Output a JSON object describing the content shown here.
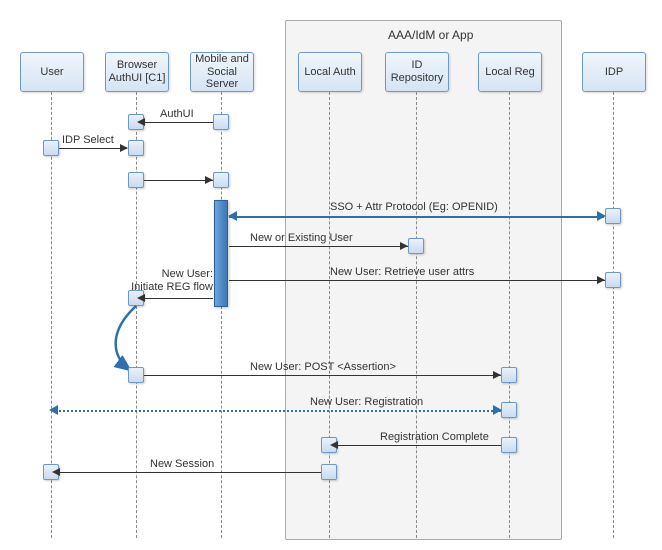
{
  "group": {
    "label": "AAA/IdM or App"
  },
  "participants": {
    "user": {
      "label": "User"
    },
    "browser": {
      "label": "Browser AuthUI [C1]"
    },
    "mss": {
      "label": "Mobile and Social Server"
    },
    "local": {
      "label": "Local Auth"
    },
    "repo": {
      "label": "ID Repository"
    },
    "reg": {
      "label": "Local Reg"
    },
    "idp": {
      "label": "IDP"
    }
  },
  "messages": {
    "authui": "AuthUI",
    "idp_select": "IDP Select",
    "sso": "SSO + Attr Protocol (Eg: OPENID)",
    "new_existing": "New or Existing User",
    "initiate": "New User:\nInitiate REG flow",
    "retrieve": "New User: Retrieve user attrs",
    "post_assert": "New User: POST <Assertion>",
    "registration": "New User: Registration",
    "reg_complete": "Registration Complete",
    "new_session": "New Session"
  },
  "chart_data": {
    "type": "sequence-diagram",
    "group": {
      "name": "AAA/IdM or App",
      "members": [
        "Local Auth",
        "ID Repository",
        "Local Reg"
      ]
    },
    "participants": [
      "User",
      "Browser AuthUI [C1]",
      "Mobile and Social Server",
      "Local Auth",
      "ID Repository",
      "Local Reg",
      "IDP"
    ],
    "interactions": [
      {
        "from": "Mobile and Social Server",
        "to": "Browser AuthUI [C1]",
        "label": "AuthUI",
        "style": "solid"
      },
      {
        "from": "User",
        "to": "Browser AuthUI [C1]",
        "label": "IDP Select",
        "style": "solid"
      },
      {
        "from": "Browser AuthUI [C1]",
        "to": "Mobile and Social Server",
        "label": "",
        "style": "solid"
      },
      {
        "from": "Mobile and Social Server",
        "to": "IDP",
        "label": "SSO + Attr Protocol (Eg: OPENID)",
        "style": "solid-double-arrow",
        "emphasis": true
      },
      {
        "from": "Mobile and Social Server",
        "to": "ID Repository",
        "label": "New or Existing User",
        "style": "solid"
      },
      {
        "from": "Mobile and Social Server",
        "to": "Browser AuthUI [C1]",
        "label": "New User:\nInitiate REG flow",
        "style": "solid"
      },
      {
        "from": "Mobile and Social Server",
        "to": "IDP",
        "label": "New User: Retrieve user attrs",
        "style": "solid"
      },
      {
        "from": "Browser AuthUI [C1]",
        "to": "Local Reg",
        "label": "New User: POST <Assertion>",
        "style": "solid",
        "via": "curved-transition"
      },
      {
        "from": "User",
        "to": "Local Reg",
        "label": "New User: Registration",
        "style": "dashed-double-arrow",
        "emphasis": true
      },
      {
        "from": "Local Reg",
        "to": "Local Auth",
        "label": "Registration Complete",
        "style": "solid"
      },
      {
        "from": "Local Auth",
        "to": "User",
        "label": "New Session",
        "style": "solid"
      }
    ]
  }
}
